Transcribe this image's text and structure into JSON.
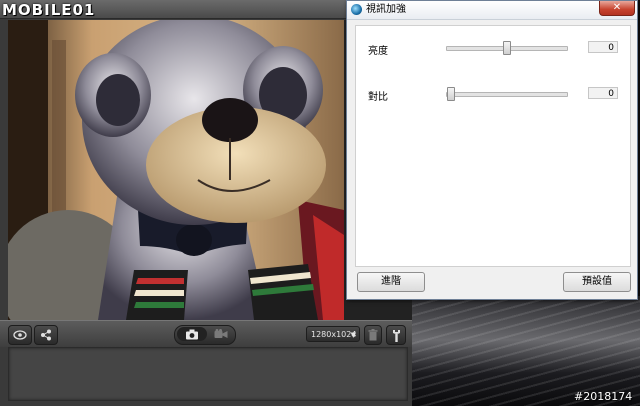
{
  "logo": {
    "text": "MOBILE01"
  },
  "dialog": {
    "title": "視訊加強",
    "close_label": "✕",
    "rows": [
      {
        "label": "亮度",
        "value": "0",
        "level": 0.5
      },
      {
        "label": "對比",
        "value": "0",
        "level": 0.0
      }
    ],
    "advanced_label": "進階",
    "default_label": "預設值"
  },
  "toolbar": {
    "resolution": "1280x1024"
  },
  "watermark": "#2018174",
  "colors": {
    "accent": "#1a6fa8",
    "close": "#c7432e",
    "toolbar": "#4a4a4a"
  }
}
